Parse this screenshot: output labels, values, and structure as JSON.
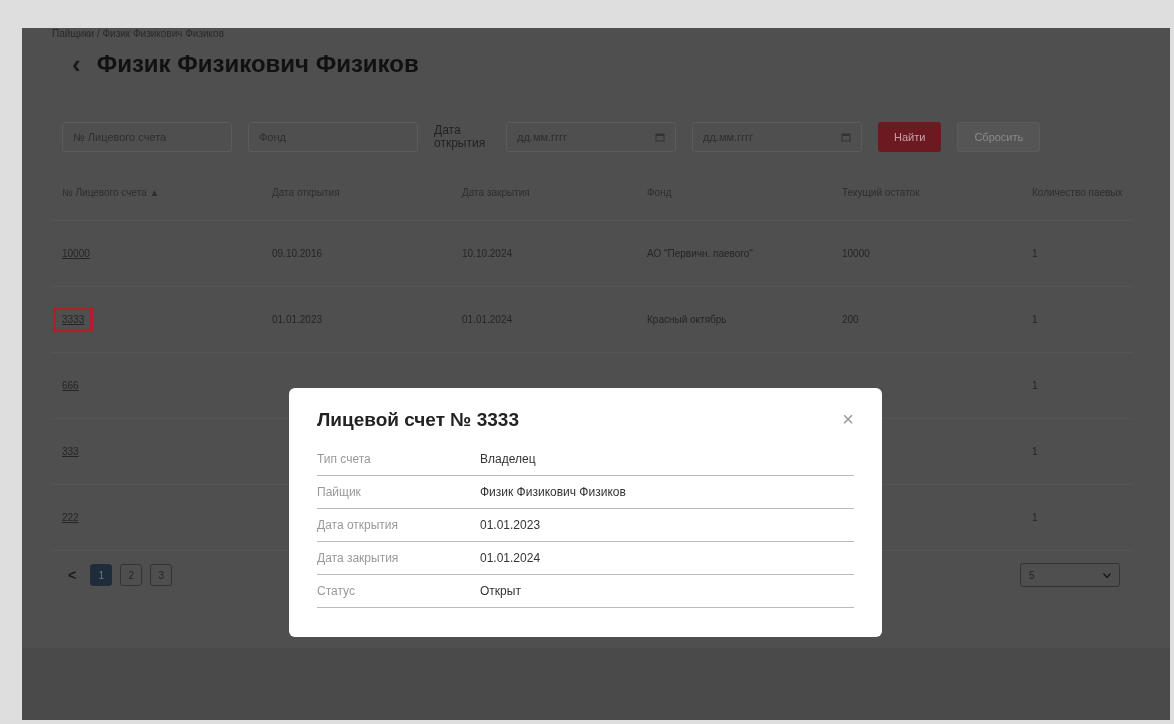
{
  "breadcrumb": "Пайщики / Физик Физикович Физиков",
  "back": "‹",
  "title": "Физик Физикович Физиков",
  "filters": {
    "account_placeholder": "№ Лицевого счета",
    "fund_placeholder": "Фонд",
    "date_label": "Дата открытия",
    "date_from_placeholder": "дд.мм.гггг",
    "date_to_placeholder": "дд.мм.гггг",
    "search_button": "Найти",
    "reset_button": "Сбросить"
  },
  "table": {
    "columns": [
      "№ Лицевого счета ▲",
      "Дата открытия",
      "Дата закрытия",
      "Фонд",
      "Текущий остаток",
      "Количество паевых"
    ],
    "rows": [
      {
        "cells": [
          "10000",
          "09.10.2016",
          "10.10.2024",
          "АО \"Первичн. паевого\"",
          "10000",
          "1"
        ],
        "highlighted": false
      },
      {
        "cells": [
          "3333",
          "01.01.2023",
          "01.01.2024",
          "Красный октябрь",
          "200",
          "1"
        ],
        "highlighted": true
      },
      {
        "cells": [
          "666",
          "",
          "",
          "",
          "",
          "1"
        ],
        "highlighted": false
      },
      {
        "cells": [
          "333",
          "",
          "",
          "",
          "",
          "1"
        ],
        "highlighted": false
      },
      {
        "cells": [
          "222",
          "",
          "",
          "",
          "",
          "1"
        ],
        "highlighted": false
      }
    ]
  },
  "pagination": {
    "prev": "<",
    "pages": [
      {
        "label": "1",
        "selected": true
      },
      {
        "label": "2",
        "selected": false
      },
      {
        "label": "3",
        "selected": false
      }
    ],
    "page_size": "5"
  },
  "modal": {
    "title": "Лицевой счет № 3333",
    "close": "×",
    "fields": [
      {
        "label": "Тип счета",
        "value": "Владелец"
      },
      {
        "label": "Пайщик",
        "value": "Физик Физикович Физиков"
      },
      {
        "label": "Дата открытия",
        "value": "01.01.2023"
      },
      {
        "label": "Дата закрытия",
        "value": "01.01.2024"
      },
      {
        "label": "Статус",
        "value": "Открыт"
      }
    ]
  }
}
